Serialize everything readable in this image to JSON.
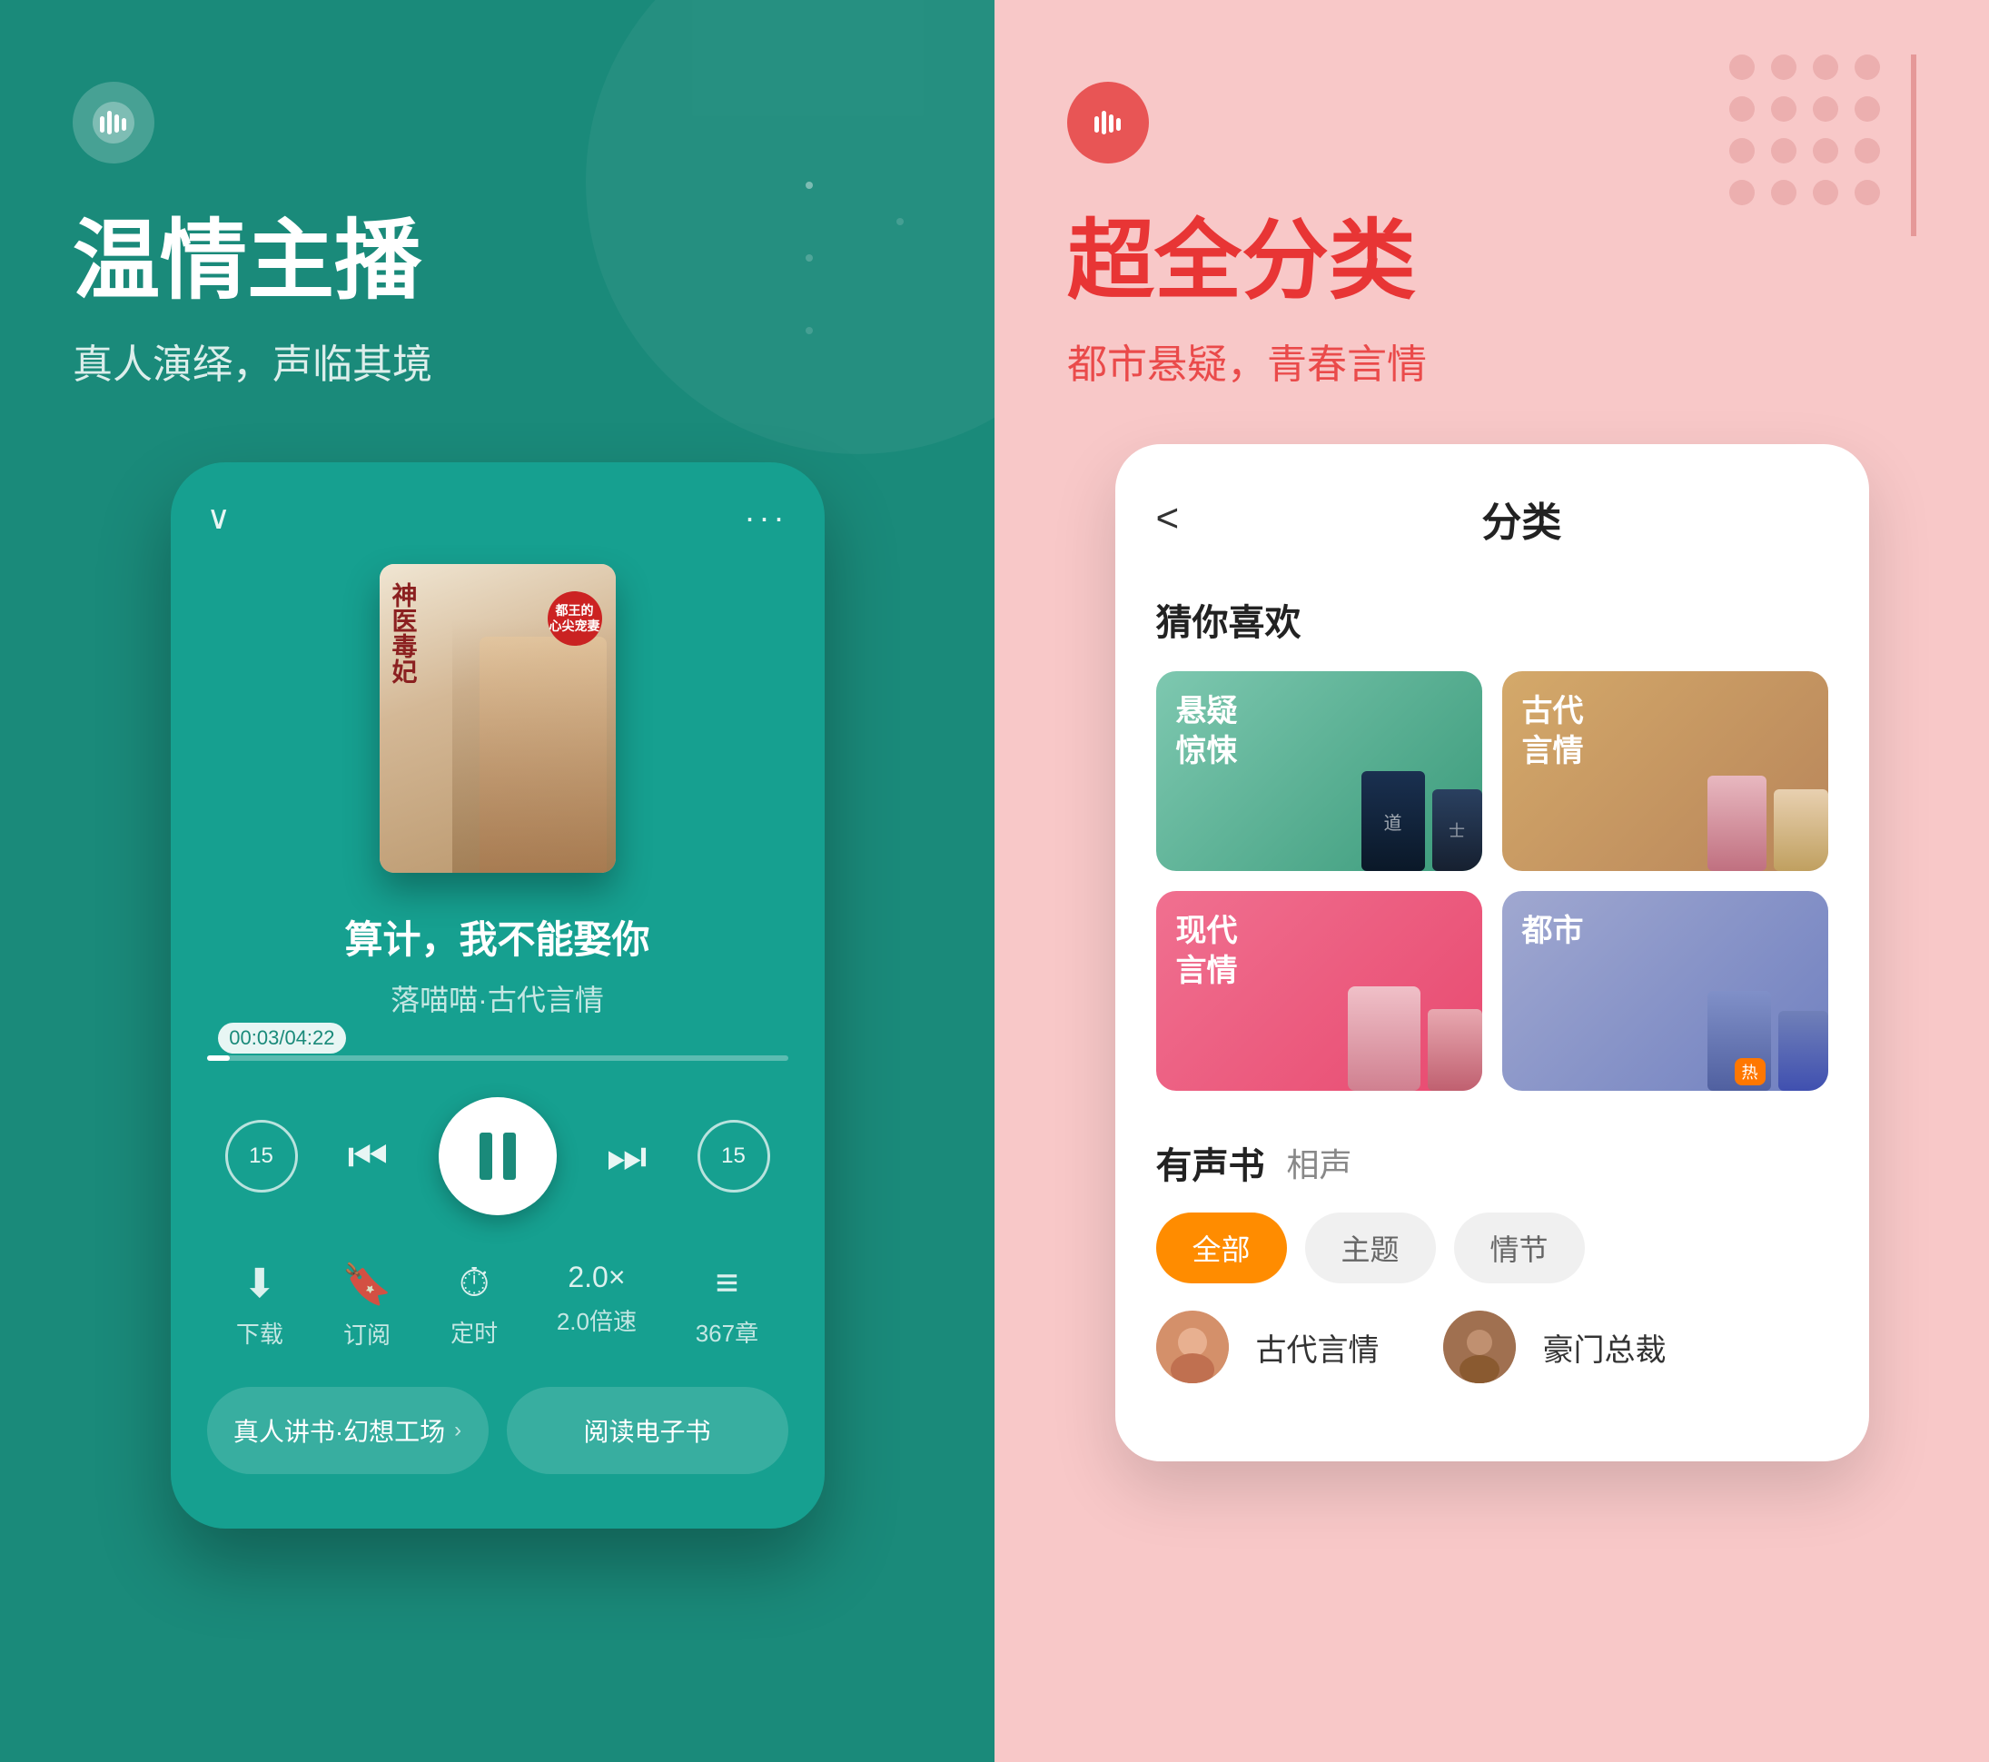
{
  "left": {
    "logo_alt": "audio-logo",
    "title": "温情主播",
    "subtitle": "真人演绎，声临其境",
    "phone": {
      "chevron": "∨",
      "dots": "···",
      "book_title_cn": "神医毒妃",
      "book_badge": "都王的心尖宠妻",
      "track_title": "算计，我不能娶你",
      "track_meta": "落喵喵·古代言情",
      "time_current": "00:03",
      "time_total": "04:22",
      "time_badge": "00:03/04:22",
      "skip_back": "15",
      "skip_fwd": "15",
      "controls": {
        "rewind_label": "15",
        "skip_prev": "⏮",
        "pause": "⏸",
        "skip_next": "⏭",
        "forward_label": "15"
      },
      "actions": [
        {
          "icon": "⬇",
          "label": "下载"
        },
        {
          "icon": "🔖",
          "label": "订阅"
        },
        {
          "icon": "⏱",
          "label": "定时"
        },
        {
          "icon": "2.0×",
          "label": "2.0倍速"
        },
        {
          "icon": "≡",
          "label": "367章"
        }
      ],
      "btn_left": "真人讲书·幻想工场",
      "btn_right": "阅读电子书"
    }
  },
  "right": {
    "logo_alt": "audio-logo-pink",
    "title": "超全分类",
    "subtitle": "都市悬疑，青春言情",
    "screen": {
      "back_label": "<",
      "title": "分类",
      "section_guess": "猜你喜欢",
      "cards": [
        {
          "label": "悬疑\n惊悚",
          "color": "green"
        },
        {
          "label": "古代\n言情",
          "color": "gold"
        },
        {
          "label": "现代\n言情",
          "color": "pink"
        },
        {
          "label": "都市",
          "color": "purple"
        }
      ],
      "section_audiobook": "有声书",
      "section_crosstalk": "相声",
      "tabs": [
        "全部",
        "主题",
        "情节"
      ],
      "active_tab": "全部",
      "categories": [
        {
          "label": "古代言情"
        },
        {
          "label": "豪门总裁"
        }
      ]
    }
  }
}
